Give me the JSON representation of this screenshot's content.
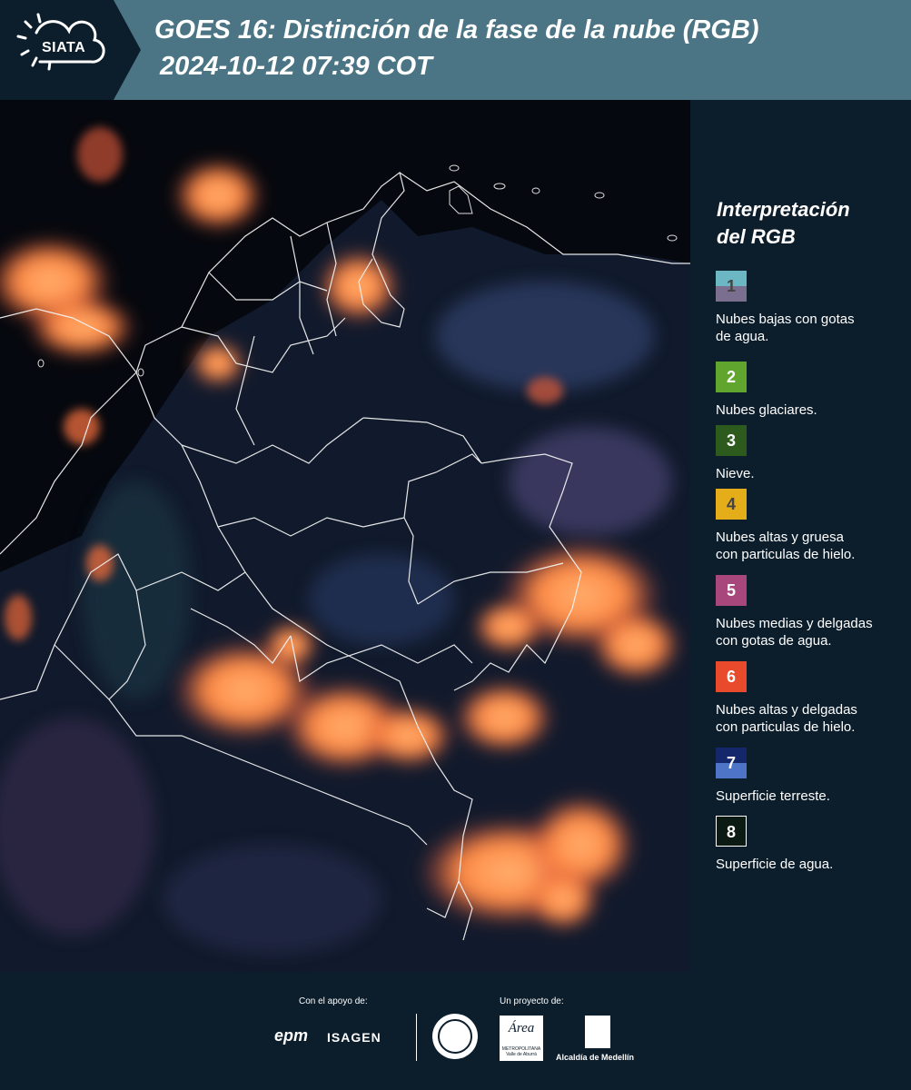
{
  "header": {
    "logo_text": "SIATA",
    "title_line1": "GOES 16: Distinción de la fase de la nube (RGB)",
    "title_line2": "2024-10-12 07:39 COT",
    "colors": {
      "band": "#4b7584",
      "logo_bg": "#0c1d2b"
    }
  },
  "legend": {
    "title_line1": "Interpretación",
    "title_line2": "del RGB",
    "items": [
      {
        "num": "1",
        "label_lines": [
          "Nubes bajas con gotas",
          "de agua."
        ],
        "color_top": "#6bb7c4",
        "color_bottom": "#7a6f8f",
        "num_color": "#444444"
      },
      {
        "num": "2",
        "label_lines": [
          "Nubes glaciares."
        ],
        "color_top": "#5fa52e",
        "color_bottom": "#5fa52e",
        "num_color": "#ffffff"
      },
      {
        "num": "3",
        "label_lines": [
          "Nieve."
        ],
        "color_top": "#2d5a1d",
        "color_bottom": "#2d5a1d",
        "num_color": "#ffffff"
      },
      {
        "num": "4",
        "label_lines": [
          "Nubes altas y gruesa",
          "con particulas de hielo."
        ],
        "color_top": "#e5ad1a",
        "color_bottom": "#e5ad1a",
        "num_color": "#444444"
      },
      {
        "num": "5",
        "label_lines": [
          "Nubes medias y delgadas",
          "con gotas de agua."
        ],
        "color_top": "#a8477c",
        "color_bottom": "#a8477c",
        "num_color": "#ffffff"
      },
      {
        "num": "6",
        "label_lines": [
          "Nubes altas y delgadas",
          "con particulas de hielo."
        ],
        "color_top": "#e94a2c",
        "color_bottom": "#e94a2c",
        "num_color": "#ffffff"
      },
      {
        "num": "7",
        "label_lines": [
          "Superficie terreste."
        ],
        "color_top": "#14276b",
        "color_bottom": "#4d74c6",
        "num_color": "#ffffff"
      },
      {
        "num": "8",
        "label_lines": [
          "Superficie de agua."
        ],
        "color_top": "#0b1a12",
        "color_bottom": "#0b1a12",
        "num_color": "#ffffff"
      }
    ]
  },
  "footer": {
    "support_label": "Con el apoyo de:",
    "project_label": "Un proyecto de:",
    "epm": "epm",
    "isagen": "ISAGEN",
    "area_logo_text": "Área",
    "area_logo_sub": "METROPOLITANA Valle de Aburrá",
    "alcaldia": "Alcaldía de Medellín"
  }
}
